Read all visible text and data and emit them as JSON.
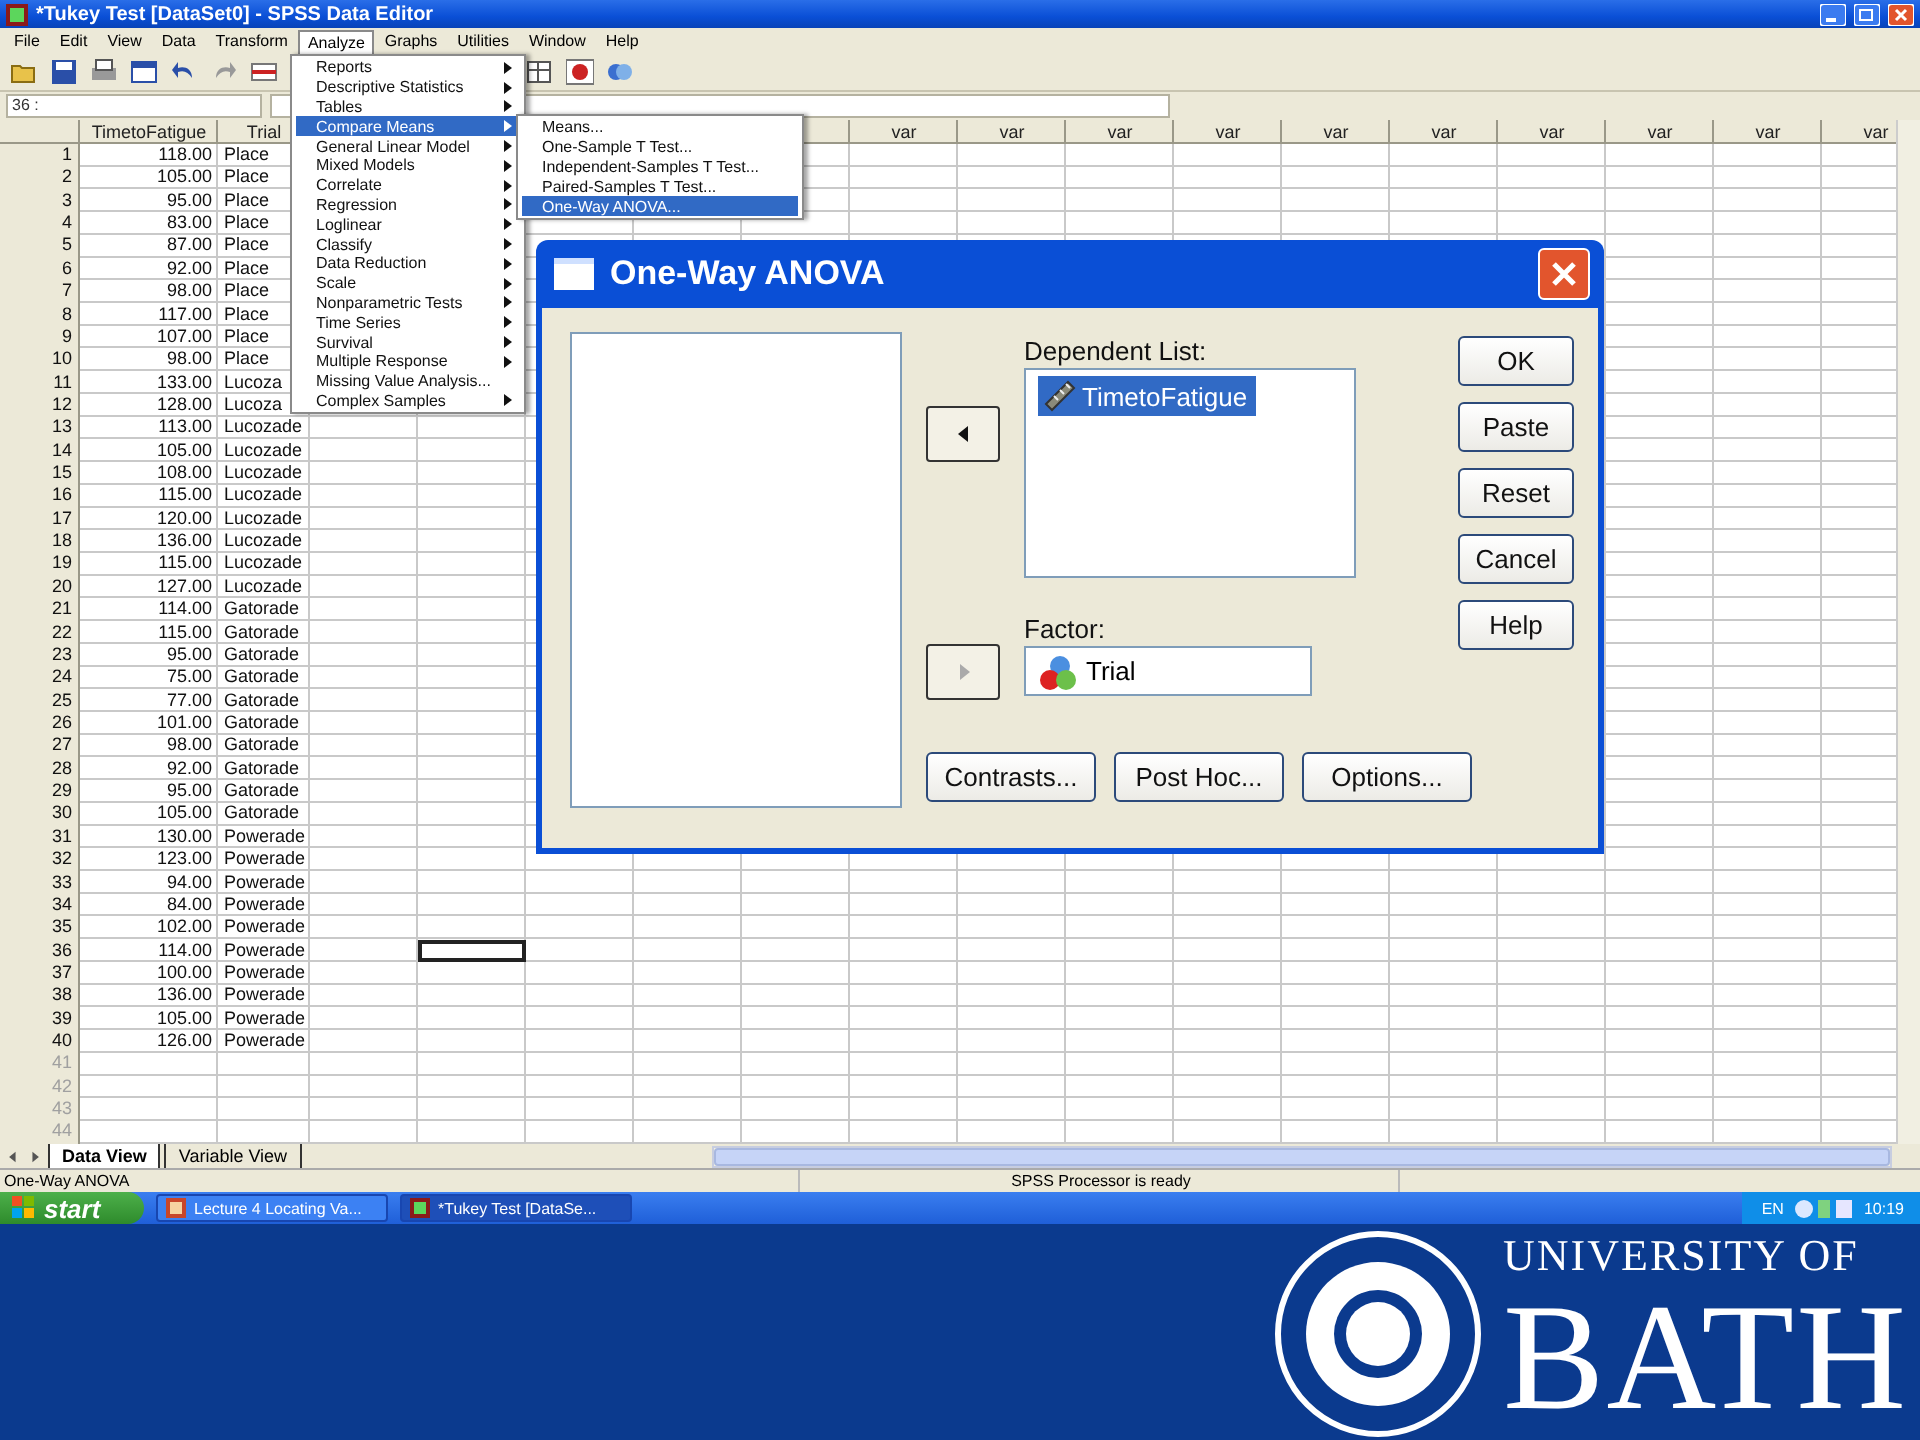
{
  "window": {
    "title": "*Tukey Test [DataSet0] - SPSS Data Editor"
  },
  "menu_bar": [
    {
      "label": "File",
      "selected": false
    },
    {
      "label": "Edit",
      "selected": false
    },
    {
      "label": "View",
      "selected": false
    },
    {
      "label": "Data",
      "selected": false
    },
    {
      "label": "Transform",
      "selected": false
    },
    {
      "label": "Analyze",
      "selected": true
    },
    {
      "label": "Graphs",
      "selected": false
    },
    {
      "label": "Utilities",
      "selected": false
    },
    {
      "label": "Window",
      "selected": false
    },
    {
      "label": "Help",
      "selected": false
    }
  ],
  "cell_editor": {
    "reference": "36 :"
  },
  "grid": {
    "columns": [
      "TimetoFatigue",
      "Trial"
    ],
    "var_headers": [
      "var",
      "var",
      "var",
      "var",
      "var",
      "var",
      "var",
      "var",
      "var",
      "var"
    ],
    "rows": [
      {
        "kind": "data",
        "number": "1",
        "time": "118.00",
        "trial": "Place"
      },
      {
        "kind": "data",
        "number": "2",
        "time": "105.00",
        "trial": "Place"
      },
      {
        "kind": "data",
        "number": "3",
        "time": "95.00",
        "trial": "Place"
      },
      {
        "kind": "data",
        "number": "4",
        "time": "83.00",
        "trial": "Place"
      },
      {
        "kind": "data",
        "number": "5",
        "time": "87.00",
        "trial": "Place"
      },
      {
        "kind": "data",
        "number": "6",
        "time": "92.00",
        "trial": "Place"
      },
      {
        "kind": "data",
        "number": "7",
        "time": "98.00",
        "trial": "Place"
      },
      {
        "kind": "data",
        "number": "8",
        "time": "117.00",
        "trial": "Place"
      },
      {
        "kind": "data",
        "number": "9",
        "time": "107.00",
        "trial": "Place"
      },
      {
        "kind": "data",
        "number": "10",
        "time": "98.00",
        "trial": "Place"
      },
      {
        "kind": "data",
        "number": "11",
        "time": "133.00",
        "trial": "Lucoza",
        "active": false
      },
      {
        "kind": "data",
        "number": "12",
        "time": "128.00",
        "trial": "Lucoza",
        "active": false
      },
      {
        "kind": "data",
        "number": "13",
        "time": "113.00",
        "trial": "Lucozade",
        "active": false
      },
      {
        "kind": "data",
        "number": "14",
        "time": "105.00",
        "trial": "Lucozade",
        "active": false
      },
      {
        "kind": "data",
        "number": "15",
        "time": "108.00",
        "trial": "Lucozade",
        "active": false
      },
      {
        "kind": "data",
        "number": "16",
        "time": "115.00",
        "trial": "Lucozade",
        "active": false
      },
      {
        "kind": "data",
        "number": "17",
        "time": "120.00",
        "trial": "Lucozade",
        "active": false
      },
      {
        "kind": "data",
        "number": "18",
        "time": "136.00",
        "trial": "Lucozade",
        "active": false
      },
      {
        "kind": "data",
        "number": "19",
        "time": "115.00",
        "trial": "Lucozade",
        "active": false
      },
      {
        "kind": "data",
        "number": "20",
        "time": "127.00",
        "trial": "Lucozade",
        "active": false
      },
      {
        "kind": "data",
        "number": "21",
        "time": "114.00",
        "trial": "Gatorade",
        "active": false
      },
      {
        "kind": "data",
        "number": "22",
        "time": "115.00",
        "trial": "Gatorade",
        "active": false
      },
      {
        "kind": "data",
        "number": "23",
        "time": "95.00",
        "trial": "Gatorade",
        "active": false
      },
      {
        "kind": "data",
        "number": "24",
        "time": "75.00",
        "trial": "Gatorade",
        "active": false
      },
      {
        "kind": "data",
        "number": "25",
        "time": "77.00",
        "trial": "Gatorade",
        "active": false
      },
      {
        "kind": "data",
        "number": "26",
        "time": "101.00",
        "trial": "Gatorade",
        "active": false
      },
      {
        "kind": "data",
        "number": "27",
        "time": "98.00",
        "trial": "Gatorade",
        "active": false
      },
      {
        "kind": "data",
        "number": "28",
        "time": "92.00",
        "trial": "Gatorade",
        "active": false
      },
      {
        "kind": "data",
        "number": "29",
        "time": "95.00",
        "trial": "Gatorade",
        "active": false
      },
      {
        "kind": "data",
        "number": "30",
        "time": "105.00",
        "trial": "Gatorade",
        "active": false
      },
      {
        "kind": "data",
        "number": "31",
        "time": "130.00",
        "trial": "Powerade",
        "active": false
      },
      {
        "kind": "data",
        "number": "32",
        "time": "123.00",
        "trial": "Powerade",
        "active": false
      },
      {
        "kind": "data",
        "number": "33",
        "time": "94.00",
        "trial": "Powerade",
        "active": false
      },
      {
        "kind": "data",
        "number": "34",
        "time": "84.00",
        "trial": "Powerade",
        "active": false
      },
      {
        "kind": "data",
        "number": "35",
        "time": "102.00",
        "trial": "Powerade",
        "active": false
      },
      {
        "kind": "data",
        "number": "36",
        "time": "114.00",
        "trial": "Powerade",
        "active": true
      },
      {
        "kind": "data",
        "number": "37",
        "time": "100.00",
        "trial": "Powerade",
        "active": false
      },
      {
        "kind": "data",
        "number": "38",
        "time": "136.00",
        "trial": "Powerade",
        "active": false
      },
      {
        "kind": "data",
        "number": "39",
        "time": "105.00",
        "trial": "Powerade",
        "active": false
      },
      {
        "kind": "data",
        "number": "40",
        "time": "126.00",
        "trial": "Powerade",
        "active": false
      },
      {
        "kind": "empty",
        "number": "41",
        "active": false
      },
      {
        "kind": "empty",
        "number": "42",
        "active": false
      },
      {
        "kind": "empty",
        "number": "43",
        "active": false
      },
      {
        "kind": "empty",
        "number": "44",
        "active": false
      }
    ]
  },
  "analyze_menu": [
    {
      "label": "Reports",
      "submenu": true,
      "selected": false
    },
    {
      "label": "Descriptive Statistics",
      "submenu": true,
      "selected": false
    },
    {
      "label": "Tables",
      "submenu": true,
      "selected": false
    },
    {
      "label": "Compare Means",
      "submenu": true,
      "selected": true
    },
    {
      "label": "General Linear Model",
      "submenu": true,
      "selected": false
    },
    {
      "label": "Mixed Models",
      "submenu": true,
      "selected": false
    },
    {
      "label": "Correlate",
      "submenu": true,
      "selected": false
    },
    {
      "label": "Regression",
      "submenu": true,
      "selected": false
    },
    {
      "label": "Loglinear",
      "submenu": true,
      "selected": false
    },
    {
      "label": "Classify",
      "submenu": true,
      "selected": false
    },
    {
      "label": "Data Reduction",
      "submenu": true,
      "selected": false
    },
    {
      "label": "Scale",
      "submenu": true,
      "selected": false
    },
    {
      "label": "Nonparametric Tests",
      "submenu": true,
      "selected": false
    },
    {
      "label": "Time Series",
      "submenu": true,
      "selected": false
    },
    {
      "label": "Survival",
      "submenu": true,
      "selected": false
    },
    {
      "label": "Multiple Response",
      "submenu": true,
      "selected": false
    },
    {
      "label": "Missing Value Analysis...",
      "submenu": false,
      "selected": false
    },
    {
      "label": "Complex Samples",
      "submenu": true,
      "selected": false
    }
  ],
  "compare_means_menu": [
    {
      "label": "Means...",
      "selected": false
    },
    {
      "label": "One-Sample T Test...",
      "selected": false
    },
    {
      "label": "Independent-Samples T Test...",
      "selected": false
    },
    {
      "label": "Paired-Samples T Test...",
      "selected": false
    },
    {
      "label": "One-Way ANOVA...",
      "selected": true
    }
  ],
  "dialog": {
    "title": "One-Way ANOVA",
    "dependent_label": "Dependent List:",
    "dependent_items": [
      {
        "label": "TimetoFatigue",
        "selected": true
      }
    ],
    "factor_label": "Factor:",
    "factor_value": "Trial",
    "move_buttons": [
      {
        "kind": "left",
        "disabled": false
      },
      {
        "kind": "right",
        "disabled": true
      }
    ],
    "side_buttons": [
      "OK",
      "Paste",
      "Reset",
      "Cancel",
      "Help"
    ],
    "bottom_buttons": [
      "Contrasts...",
      "Post Hoc...",
      "Options..."
    ]
  },
  "sheet_tabs": [
    {
      "label": "Data View",
      "selected": true
    },
    {
      "label": "Variable View",
      "selected": false
    }
  ],
  "status_bar": {
    "message": "One-Way ANOVA",
    "processor": "SPSS Processor is ready"
  },
  "taskbar": {
    "start": "start",
    "tasks": [
      {
        "label": "Lecture 4 Locating Va...",
        "selected": false
      },
      {
        "label": "*Tukey Test [DataSe...",
        "selected": true
      }
    ],
    "language": "EN",
    "clock": "10:19"
  },
  "footer": {
    "university": "UNIVERSITY OF",
    "name": "BATH"
  }
}
